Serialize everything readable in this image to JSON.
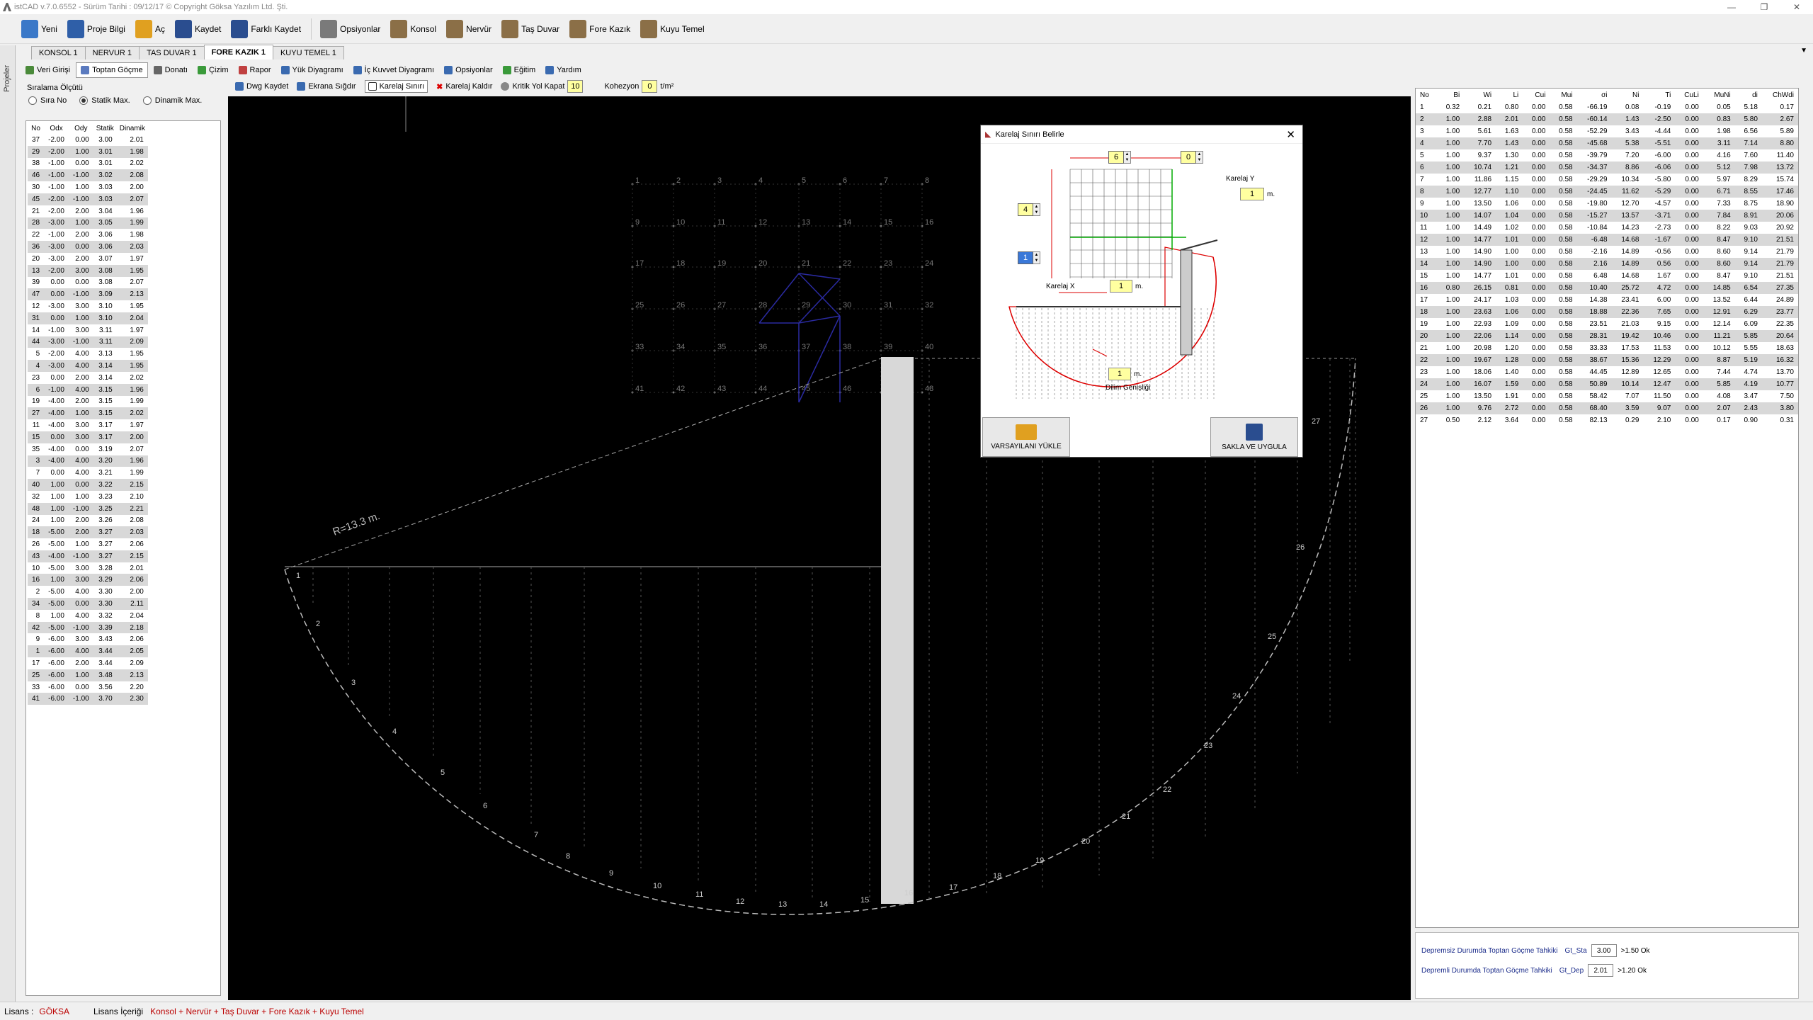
{
  "window": {
    "title": "istCAD v.7.0.6552 -  Sürüm Tarihi : 09/12/17   © Copyright Göksa Yazılım Ltd. Şti."
  },
  "toolbar": [
    {
      "label": "Yeni",
      "icon": "new-file-icon",
      "color": "#3a78c8"
    },
    {
      "label": "Proje Bilgi",
      "icon": "info-icon",
      "color": "#2f5fa8"
    },
    {
      "label": "Aç",
      "icon": "folder-open-icon",
      "color": "#e0a020"
    },
    {
      "label": "Kaydet",
      "icon": "save-icon",
      "color": "#2a4d8f"
    },
    {
      "label": "Farklı Kaydet",
      "icon": "save-as-icon",
      "color": "#2a4d8f"
    },
    {
      "label": "Opsiyonlar",
      "icon": "gear-icon",
      "color": "#7a7a7a"
    },
    {
      "label": "Konsol",
      "icon": "konsol-icon",
      "color": "#8b6f47"
    },
    {
      "label": "Nervür",
      "icon": "nervur-icon",
      "color": "#8b6f47"
    },
    {
      "label": "Taş Duvar",
      "icon": "tas-duvar-icon",
      "color": "#8b6f47"
    },
    {
      "label": "Fore Kazık",
      "icon": "fore-kazik-icon",
      "color": "#8b6f47"
    },
    {
      "label": "Kuyu Temel",
      "icon": "kuyu-temel-icon",
      "color": "#8b6f47"
    }
  ],
  "tabs": [
    {
      "label": "KONSOL 1",
      "active": false
    },
    {
      "label": "NERVUR 1",
      "active": false
    },
    {
      "label": "TAS DUVAR 1",
      "active": false
    },
    {
      "label": "FORE KAZIK 1",
      "active": true
    },
    {
      "label": "KUYU TEMEL 1",
      "active": false
    }
  ],
  "sidebar_strip": {
    "label": "Projeler"
  },
  "subtoolbar": [
    {
      "label": "Veri Girişi",
      "icon": "data-entry-icon",
      "active": false
    },
    {
      "label": "Toptan Göçme",
      "icon": "collapse-icon",
      "active": true
    },
    {
      "label": "Donatı",
      "icon": "rebar-icon",
      "active": false
    },
    {
      "label": "Çizim",
      "icon": "drawing-icon",
      "active": false
    },
    {
      "label": "Rapor",
      "icon": "report-icon",
      "active": false
    },
    {
      "label": "Yük Diyagramı",
      "icon": "load-diagram-icon",
      "active": false
    },
    {
      "label": "İç Kuvvet Diyagramı",
      "icon": "internal-force-icon",
      "active": false
    },
    {
      "label": "Opsiyonlar",
      "icon": "options-icon",
      "active": false
    },
    {
      "label": "Eğitim",
      "icon": "training-icon",
      "active": false
    },
    {
      "label": "Yardım",
      "icon": "help-icon",
      "active": false
    }
  ],
  "drawing_toolbar": {
    "dwg_save": "Dwg Kaydet",
    "fit_screen": "Ekrana Sığdır",
    "grid_bound": "Karelaj Sınırı",
    "grid_remove": "Karelaj Kaldır",
    "critical_path": "Kritik Yol Kapat",
    "critical_value": "10",
    "cohesion_label": "Kohezyon",
    "cohesion_value": "0",
    "cohesion_unit": "t/m²"
  },
  "sort": {
    "title": "Sıralama Ölçütü",
    "options": [
      {
        "label": "Sıra No",
        "checked": false
      },
      {
        "label": "Statik Max.",
        "checked": true
      },
      {
        "label": "Dinamik Max.",
        "checked": false
      }
    ]
  },
  "left_table": {
    "headers": [
      "No",
      "Odx",
      "Ody",
      "Statik",
      "Dinamik"
    ],
    "rows": [
      [
        "37",
        "-2.00",
        "0.00",
        "3.00",
        "2.01"
      ],
      [
        "29",
        "-2.00",
        "1.00",
        "3.01",
        "1.98"
      ],
      [
        "38",
        "-1.00",
        "0.00",
        "3.01",
        "2.02"
      ],
      [
        "46",
        "-1.00",
        "-1.00",
        "3.02",
        "2.08"
      ],
      [
        "30",
        "-1.00",
        "1.00",
        "3.03",
        "2.00"
      ],
      [
        "45",
        "-2.00",
        "-1.00",
        "3.03",
        "2.07"
      ],
      [
        "21",
        "-2.00",
        "2.00",
        "3.04",
        "1.96"
      ],
      [
        "28",
        "-3.00",
        "1.00",
        "3.05",
        "1.99"
      ],
      [
        "22",
        "-1.00",
        "2.00",
        "3.06",
        "1.98"
      ],
      [
        "36",
        "-3.00",
        "0.00",
        "3.06",
        "2.03"
      ],
      [
        "20",
        "-3.00",
        "2.00",
        "3.07",
        "1.97"
      ],
      [
        "13",
        "-2.00",
        "3.00",
        "3.08",
        "1.95"
      ],
      [
        "39",
        "0.00",
        "0.00",
        "3.08",
        "2.07"
      ],
      [
        "47",
        "0.00",
        "-1.00",
        "3.09",
        "2.13"
      ],
      [
        "12",
        "-3.00",
        "3.00",
        "3.10",
        "1.95"
      ],
      [
        "31",
        "0.00",
        "1.00",
        "3.10",
        "2.04"
      ],
      [
        "14",
        "-1.00",
        "3.00",
        "3.11",
        "1.97"
      ],
      [
        "44",
        "-3.00",
        "-1.00",
        "3.11",
        "2.09"
      ],
      [
        "5",
        "-2.00",
        "4.00",
        "3.13",
        "1.95"
      ],
      [
        "4",
        "-3.00",
        "4.00",
        "3.14",
        "1.95"
      ],
      [
        "23",
        "0.00",
        "2.00",
        "3.14",
        "2.02"
      ],
      [
        "6",
        "-1.00",
        "4.00",
        "3.15",
        "1.96"
      ],
      [
        "19",
        "-4.00",
        "2.00",
        "3.15",
        "1.99"
      ],
      [
        "27",
        "-4.00",
        "1.00",
        "3.15",
        "2.02"
      ],
      [
        "11",
        "-4.00",
        "3.00",
        "3.17",
        "1.97"
      ],
      [
        "15",
        "0.00",
        "3.00",
        "3.17",
        "2.00"
      ],
      [
        "35",
        "-4.00",
        "0.00",
        "3.19",
        "2.07"
      ],
      [
        "3",
        "-4.00",
        "4.00",
        "3.20",
        "1.96"
      ],
      [
        "7",
        "0.00",
        "4.00",
        "3.21",
        "1.99"
      ],
      [
        "40",
        "1.00",
        "0.00",
        "3.22",
        "2.15"
      ],
      [
        "32",
        "1.00",
        "1.00",
        "3.23",
        "2.10"
      ],
      [
        "48",
        "1.00",
        "-1.00",
        "3.25",
        "2.21"
      ],
      [
        "24",
        "1.00",
        "2.00",
        "3.26",
        "2.08"
      ],
      [
        "18",
        "-5.00",
        "2.00",
        "3.27",
        "2.03"
      ],
      [
        "26",
        "-5.00",
        "1.00",
        "3.27",
        "2.06"
      ],
      [
        "43",
        "-4.00",
        "-1.00",
        "3.27",
        "2.15"
      ],
      [
        "10",
        "-5.00",
        "3.00",
        "3.28",
        "2.01"
      ],
      [
        "16",
        "1.00",
        "3.00",
        "3.29",
        "2.06"
      ],
      [
        "2",
        "-5.00",
        "4.00",
        "3.30",
        "2.00"
      ],
      [
        "34",
        "-5.00",
        "0.00",
        "3.30",
        "2.11"
      ],
      [
        "8",
        "1.00",
        "4.00",
        "3.32",
        "2.04"
      ],
      [
        "42",
        "-5.00",
        "-1.00",
        "3.39",
        "2.18"
      ],
      [
        "9",
        "-6.00",
        "3.00",
        "3.43",
        "2.06"
      ],
      [
        "1",
        "-6.00",
        "4.00",
        "3.44",
        "2.05"
      ],
      [
        "17",
        "-6.00",
        "2.00",
        "3.44",
        "2.09"
      ],
      [
        "25",
        "-6.00",
        "1.00",
        "3.48",
        "2.13"
      ],
      [
        "33",
        "-6.00",
        "0.00",
        "3.56",
        "2.20"
      ],
      [
        "41",
        "-6.00",
        "-1.00",
        "3.70",
        "2.30"
      ]
    ]
  },
  "right_table": {
    "headers": [
      "No",
      "Bi",
      "Wi",
      "Li",
      "Cui",
      "Mui",
      "σi",
      "Ni",
      "Ti",
      "CuLi",
      "MuNi",
      "di",
      "ChWdi"
    ],
    "rows": [
      [
        "1",
        "0.32",
        "0.21",
        "0.80",
        "0.00",
        "0.58",
        "-66.19",
        "0.08",
        "-0.19",
        "0.00",
        "0.05",
        "5.18",
        "0.17"
      ],
      [
        "2",
        "1.00",
        "2.88",
        "2.01",
        "0.00",
        "0.58",
        "-60.14",
        "1.43",
        "-2.50",
        "0.00",
        "0.83",
        "5.80",
        "2.67"
      ],
      [
        "3",
        "1.00",
        "5.61",
        "1.63",
        "0.00",
        "0.58",
        "-52.29",
        "3.43",
        "-4.44",
        "0.00",
        "1.98",
        "6.56",
        "5.89"
      ],
      [
        "4",
        "1.00",
        "7.70",
        "1.43",
        "0.00",
        "0.58",
        "-45.68",
        "5.38",
        "-5.51",
        "0.00",
        "3.11",
        "7.14",
        "8.80"
      ],
      [
        "5",
        "1.00",
        "9.37",
        "1.30",
        "0.00",
        "0.58",
        "-39.79",
        "7.20",
        "-6.00",
        "0.00",
        "4.16",
        "7.60",
        "11.40"
      ],
      [
        "6",
        "1.00",
        "10.74",
        "1.21",
        "0.00",
        "0.58",
        "-34.37",
        "8.86",
        "-6.06",
        "0.00",
        "5.12",
        "7.98",
        "13.72"
      ],
      [
        "7",
        "1.00",
        "11.86",
        "1.15",
        "0.00",
        "0.58",
        "-29.29",
        "10.34",
        "-5.80",
        "0.00",
        "5.97",
        "8.29",
        "15.74"
      ],
      [
        "8",
        "1.00",
        "12.77",
        "1.10",
        "0.00",
        "0.58",
        "-24.45",
        "11.62",
        "-5.29",
        "0.00",
        "6.71",
        "8.55",
        "17.46"
      ],
      [
        "9",
        "1.00",
        "13.50",
        "1.06",
        "0.00",
        "0.58",
        "-19.80",
        "12.70",
        "-4.57",
        "0.00",
        "7.33",
        "8.75",
        "18.90"
      ],
      [
        "10",
        "1.00",
        "14.07",
        "1.04",
        "0.00",
        "0.58",
        "-15.27",
        "13.57",
        "-3.71",
        "0.00",
        "7.84",
        "8.91",
        "20.06"
      ],
      [
        "11",
        "1.00",
        "14.49",
        "1.02",
        "0.00",
        "0.58",
        "-10.84",
        "14.23",
        "-2.73",
        "0.00",
        "8.22",
        "9.03",
        "20.92"
      ],
      [
        "12",
        "1.00",
        "14.77",
        "1.01",
        "0.00",
        "0.58",
        "-6.48",
        "14.68",
        "-1.67",
        "0.00",
        "8.47",
        "9.10",
        "21.51"
      ],
      [
        "13",
        "1.00",
        "14.90",
        "1.00",
        "0.00",
        "0.58",
        "-2.16",
        "14.89",
        "-0.56",
        "0.00",
        "8.60",
        "9.14",
        "21.79"
      ],
      [
        "14",
        "1.00",
        "14.90",
        "1.00",
        "0.00",
        "0.58",
        "2.16",
        "14.89",
        "0.56",
        "0.00",
        "8.60",
        "9.14",
        "21.79"
      ],
      [
        "15",
        "1.00",
        "14.77",
        "1.01",
        "0.00",
        "0.58",
        "6.48",
        "14.68",
        "1.67",
        "0.00",
        "8.47",
        "9.10",
        "21.51"
      ],
      [
        "16",
        "0.80",
        "26.15",
        "0.81",
        "0.00",
        "0.58",
        "10.40",
        "25.72",
        "4.72",
        "0.00",
        "14.85",
        "6.54",
        "27.35"
      ],
      [
        "17",
        "1.00",
        "24.17",
        "1.03",
        "0.00",
        "0.58",
        "14.38",
        "23.41",
        "6.00",
        "0.00",
        "13.52",
        "6.44",
        "24.89"
      ],
      [
        "18",
        "1.00",
        "23.63",
        "1.06",
        "0.00",
        "0.58",
        "18.88",
        "22.36",
        "7.65",
        "0.00",
        "12.91",
        "6.29",
        "23.77"
      ],
      [
        "19",
        "1.00",
        "22.93",
        "1.09",
        "0.00",
        "0.58",
        "23.51",
        "21.03",
        "9.15",
        "0.00",
        "12.14",
        "6.09",
        "22.35"
      ],
      [
        "20",
        "1.00",
        "22.06",
        "1.14",
        "0.00",
        "0.58",
        "28.31",
        "19.42",
        "10.46",
        "0.00",
        "11.21",
        "5.85",
        "20.64"
      ],
      [
        "21",
        "1.00",
        "20.98",
        "1.20",
        "0.00",
        "0.58",
        "33.33",
        "17.53",
        "11.53",
        "0.00",
        "10.12",
        "5.55",
        "18.63"
      ],
      [
        "22",
        "1.00",
        "19.67",
        "1.28",
        "0.00",
        "0.58",
        "38.67",
        "15.36",
        "12.29",
        "0.00",
        "8.87",
        "5.19",
        "16.32"
      ],
      [
        "23",
        "1.00",
        "18.06",
        "1.40",
        "0.00",
        "0.58",
        "44.45",
        "12.89",
        "12.65",
        "0.00",
        "7.44",
        "4.74",
        "13.70"
      ],
      [
        "24",
        "1.00",
        "16.07",
        "1.59",
        "0.00",
        "0.58",
        "50.89",
        "10.14",
        "12.47",
        "0.00",
        "5.85",
        "4.19",
        "10.77"
      ],
      [
        "25",
        "1.00",
        "13.50",
        "1.91",
        "0.00",
        "0.58",
        "58.42",
        "7.07",
        "11.50",
        "0.00",
        "4.08",
        "3.47",
        "7.50"
      ],
      [
        "26",
        "1.00",
        "9.76",
        "2.72",
        "0.00",
        "0.58",
        "68.40",
        "3.59",
        "9.07",
        "0.00",
        "2.07",
        "2.43",
        "3.80"
      ],
      [
        "27",
        "0.50",
        "2.12",
        "3.64",
        "0.00",
        "0.58",
        "82.13",
        "0.29",
        "2.10",
        "0.00",
        "0.17",
        "0.90",
        "0.31"
      ]
    ]
  },
  "checks": [
    {
      "label": "Depremsiz Durumda Toptan Göçme Tahkiki",
      "key": "Gt_Sta",
      "value": "3.00",
      "result": ">1.50 Ok"
    },
    {
      "label": "Depremli Durumda Toptan Göçme Tahkiki",
      "key": "Gt_Dep",
      "value": "2.01",
      "result": ">1.20 Ok"
    }
  ],
  "status": {
    "license_label": "Lisans :",
    "license_user": "GÖKSA",
    "content_label": "Lisans İçeriği",
    "content_value": "Konsol + Nervür + Taş Duvar + Fore Kazık + Kuyu Temel"
  },
  "dialog": {
    "title": "Karelaj Sınırı Belirle",
    "top_left_value": "6",
    "top_right_value": "0",
    "left_upper_value": "4",
    "left_lower_value": "1",
    "karelaj_y_label": "Karelaj Y",
    "karelaj_y_value": "1",
    "karelaj_x_label": "Karelaj X",
    "karelaj_x_value": "1",
    "unit": "m.",
    "dilim_value": "1",
    "dilim_label": "Dilim Genişliği",
    "load_default": "VARSAYILANI YÜKLE",
    "save_apply": "SAKLA VE UYGULA"
  },
  "drawing": {
    "radius_label": "R=13.3 m.",
    "slice_count": 27,
    "grid_cols": 8,
    "grid_rows": 6
  }
}
